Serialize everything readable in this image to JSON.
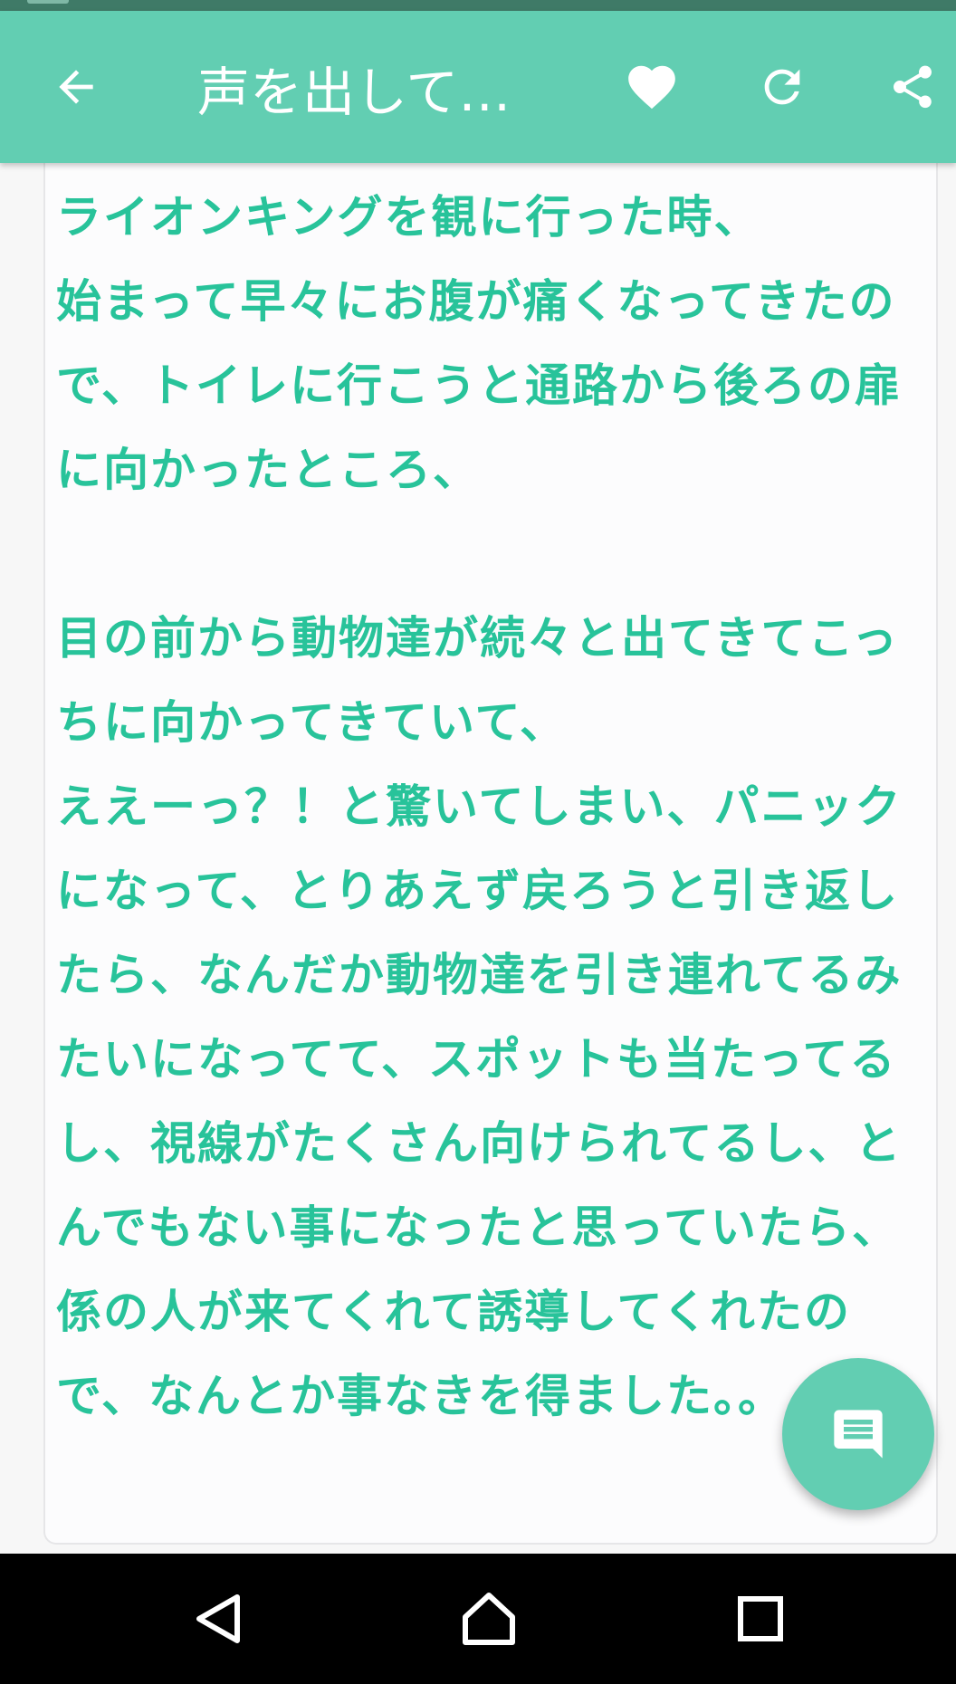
{
  "header": {
    "title": "声を出して笑..."
  },
  "post": {
    "body": "ライオンキングを観に行った時、\n始まって早々にお腹が痛くなってきたので、トイレに行こうと通路から後ろの扉に向かったところ、\n\n目の前から動物達が続々と出てきてこっちに向かってきていて、\nええーっ？！と驚いてしまい、パニックになって、とりあえず戻ろうと引き返したら、なんだか動物達を引き連れてるみたいになってて、スポットも当たってるし、視線がたくさん向けられてるし、とんでもない事になったと思っていたら、係の人が来てくれて誘導してくれたので、なんとか事なきを得ました。。"
  },
  "icons": {
    "back": "arrow-left-icon",
    "favorite": "heart-icon",
    "reload": "refresh-icon",
    "share": "share-icon",
    "comment": "comment-icon",
    "nav_back": "triangle-back-icon",
    "nav_home": "home-icon",
    "nav_recents": "square-recents-icon"
  },
  "colors": {
    "app_bar": "#62ceb2",
    "status_bar": "#3f7a67",
    "text_accent": "#28c39a",
    "card_background": "#fcfcfd",
    "nav_bar": "#000000"
  }
}
